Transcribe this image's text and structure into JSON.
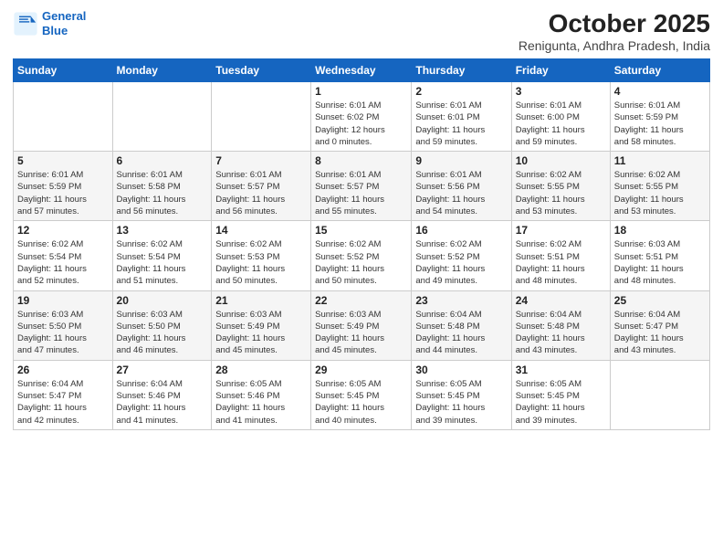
{
  "logo": {
    "line1": "General",
    "line2": "Blue"
  },
  "title": "October 2025",
  "location": "Renigunta, Andhra Pradesh, India",
  "days_of_week": [
    "Sunday",
    "Monday",
    "Tuesday",
    "Wednesday",
    "Thursday",
    "Friday",
    "Saturday"
  ],
  "weeks": [
    [
      {
        "day": "",
        "info": ""
      },
      {
        "day": "",
        "info": ""
      },
      {
        "day": "",
        "info": ""
      },
      {
        "day": "1",
        "info": "Sunrise: 6:01 AM\nSunset: 6:02 PM\nDaylight: 12 hours\nand 0 minutes."
      },
      {
        "day": "2",
        "info": "Sunrise: 6:01 AM\nSunset: 6:01 PM\nDaylight: 11 hours\nand 59 minutes."
      },
      {
        "day": "3",
        "info": "Sunrise: 6:01 AM\nSunset: 6:00 PM\nDaylight: 11 hours\nand 59 minutes."
      },
      {
        "day": "4",
        "info": "Sunrise: 6:01 AM\nSunset: 5:59 PM\nDaylight: 11 hours\nand 58 minutes."
      }
    ],
    [
      {
        "day": "5",
        "info": "Sunrise: 6:01 AM\nSunset: 5:59 PM\nDaylight: 11 hours\nand 57 minutes."
      },
      {
        "day": "6",
        "info": "Sunrise: 6:01 AM\nSunset: 5:58 PM\nDaylight: 11 hours\nand 56 minutes."
      },
      {
        "day": "7",
        "info": "Sunrise: 6:01 AM\nSunset: 5:57 PM\nDaylight: 11 hours\nand 56 minutes."
      },
      {
        "day": "8",
        "info": "Sunrise: 6:01 AM\nSunset: 5:57 PM\nDaylight: 11 hours\nand 55 minutes."
      },
      {
        "day": "9",
        "info": "Sunrise: 6:01 AM\nSunset: 5:56 PM\nDaylight: 11 hours\nand 54 minutes."
      },
      {
        "day": "10",
        "info": "Sunrise: 6:02 AM\nSunset: 5:55 PM\nDaylight: 11 hours\nand 53 minutes."
      },
      {
        "day": "11",
        "info": "Sunrise: 6:02 AM\nSunset: 5:55 PM\nDaylight: 11 hours\nand 53 minutes."
      }
    ],
    [
      {
        "day": "12",
        "info": "Sunrise: 6:02 AM\nSunset: 5:54 PM\nDaylight: 11 hours\nand 52 minutes."
      },
      {
        "day": "13",
        "info": "Sunrise: 6:02 AM\nSunset: 5:54 PM\nDaylight: 11 hours\nand 51 minutes."
      },
      {
        "day": "14",
        "info": "Sunrise: 6:02 AM\nSunset: 5:53 PM\nDaylight: 11 hours\nand 50 minutes."
      },
      {
        "day": "15",
        "info": "Sunrise: 6:02 AM\nSunset: 5:52 PM\nDaylight: 11 hours\nand 50 minutes."
      },
      {
        "day": "16",
        "info": "Sunrise: 6:02 AM\nSunset: 5:52 PM\nDaylight: 11 hours\nand 49 minutes."
      },
      {
        "day": "17",
        "info": "Sunrise: 6:02 AM\nSunset: 5:51 PM\nDaylight: 11 hours\nand 48 minutes."
      },
      {
        "day": "18",
        "info": "Sunrise: 6:03 AM\nSunset: 5:51 PM\nDaylight: 11 hours\nand 48 minutes."
      }
    ],
    [
      {
        "day": "19",
        "info": "Sunrise: 6:03 AM\nSunset: 5:50 PM\nDaylight: 11 hours\nand 47 minutes."
      },
      {
        "day": "20",
        "info": "Sunrise: 6:03 AM\nSunset: 5:50 PM\nDaylight: 11 hours\nand 46 minutes."
      },
      {
        "day": "21",
        "info": "Sunrise: 6:03 AM\nSunset: 5:49 PM\nDaylight: 11 hours\nand 45 minutes."
      },
      {
        "day": "22",
        "info": "Sunrise: 6:03 AM\nSunset: 5:49 PM\nDaylight: 11 hours\nand 45 minutes."
      },
      {
        "day": "23",
        "info": "Sunrise: 6:04 AM\nSunset: 5:48 PM\nDaylight: 11 hours\nand 44 minutes."
      },
      {
        "day": "24",
        "info": "Sunrise: 6:04 AM\nSunset: 5:48 PM\nDaylight: 11 hours\nand 43 minutes."
      },
      {
        "day": "25",
        "info": "Sunrise: 6:04 AM\nSunset: 5:47 PM\nDaylight: 11 hours\nand 43 minutes."
      }
    ],
    [
      {
        "day": "26",
        "info": "Sunrise: 6:04 AM\nSunset: 5:47 PM\nDaylight: 11 hours\nand 42 minutes."
      },
      {
        "day": "27",
        "info": "Sunrise: 6:04 AM\nSunset: 5:46 PM\nDaylight: 11 hours\nand 41 minutes."
      },
      {
        "day": "28",
        "info": "Sunrise: 6:05 AM\nSunset: 5:46 PM\nDaylight: 11 hours\nand 41 minutes."
      },
      {
        "day": "29",
        "info": "Sunrise: 6:05 AM\nSunset: 5:45 PM\nDaylight: 11 hours\nand 40 minutes."
      },
      {
        "day": "30",
        "info": "Sunrise: 6:05 AM\nSunset: 5:45 PM\nDaylight: 11 hours\nand 39 minutes."
      },
      {
        "day": "31",
        "info": "Sunrise: 6:05 AM\nSunset: 5:45 PM\nDaylight: 11 hours\nand 39 minutes."
      },
      {
        "day": "",
        "info": ""
      }
    ]
  ]
}
